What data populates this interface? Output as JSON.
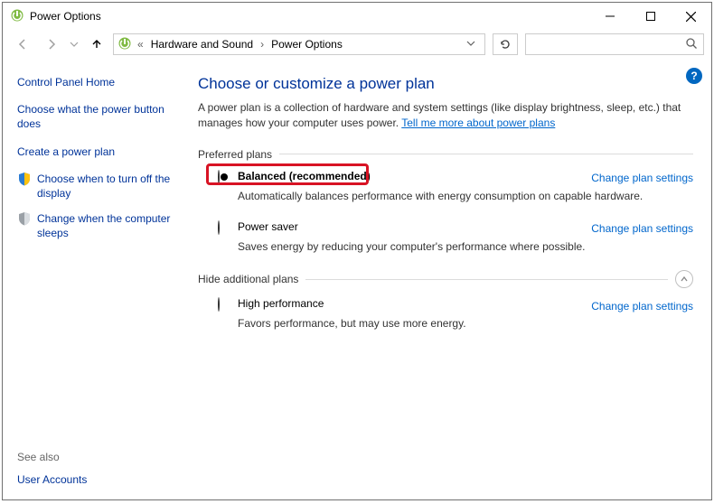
{
  "window": {
    "title": "Power Options"
  },
  "breadcrumbs": {
    "parent": "Hardware and Sound",
    "current": "Power Options",
    "prefix": "«"
  },
  "search": {
    "placeholder": ""
  },
  "sidebar": {
    "home": "Control Panel Home",
    "links": [
      "Choose what the power button does",
      "Create a power plan",
      "Choose when to turn off the display",
      "Change when the computer sleeps"
    ],
    "see_also_header": "See also",
    "see_also_links": [
      "User Accounts"
    ]
  },
  "main": {
    "heading": "Choose or customize a power plan",
    "intro_a": "A power plan is a collection of hardware and system settings (like display brightness, sleep, etc.) that manages how your computer uses power. ",
    "intro_link": "Tell me more about power plans",
    "preferred_legend": "Preferred plans",
    "hidden_legend": "Hide additional plans",
    "change_link": "Change plan settings",
    "plans": {
      "balanced": {
        "label": "Balanced (recommended)",
        "desc": "Automatically balances performance with energy consumption on capable hardware.",
        "selected": true
      },
      "powersaver": {
        "label": "Power saver",
        "desc": "Saves energy by reducing your computer's performance where possible.",
        "selected": false
      },
      "highperf": {
        "label": "High performance",
        "desc": "Favors performance, but may use more energy.",
        "selected": false
      }
    }
  },
  "help_glyph": "?"
}
